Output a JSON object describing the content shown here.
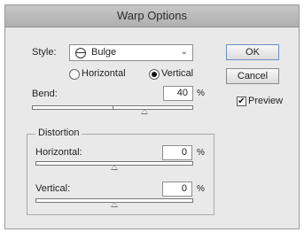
{
  "window": {
    "title": "Warp Options"
  },
  "style": {
    "label": "Style:",
    "selected": "Bulge",
    "icon": "bulge-icon"
  },
  "orientation": {
    "horizontal_label": "Horizontal",
    "vertical_label": "Vertical",
    "selected": "Vertical"
  },
  "bend": {
    "label": "Bend:",
    "value": "40",
    "unit": "%",
    "level": 0.7
  },
  "distortion": {
    "title": "Distortion",
    "horizontal": {
      "label": "Horizontal:",
      "value": "0",
      "unit": "%",
      "level": 0.5
    },
    "vertical": {
      "label": "Vertical:",
      "value": "0",
      "unit": "%",
      "level": 0.5
    }
  },
  "buttons": {
    "ok": "OK",
    "cancel": "Cancel"
  },
  "preview": {
    "label": "Preview",
    "checked": true,
    "check_glyph": "✔"
  }
}
